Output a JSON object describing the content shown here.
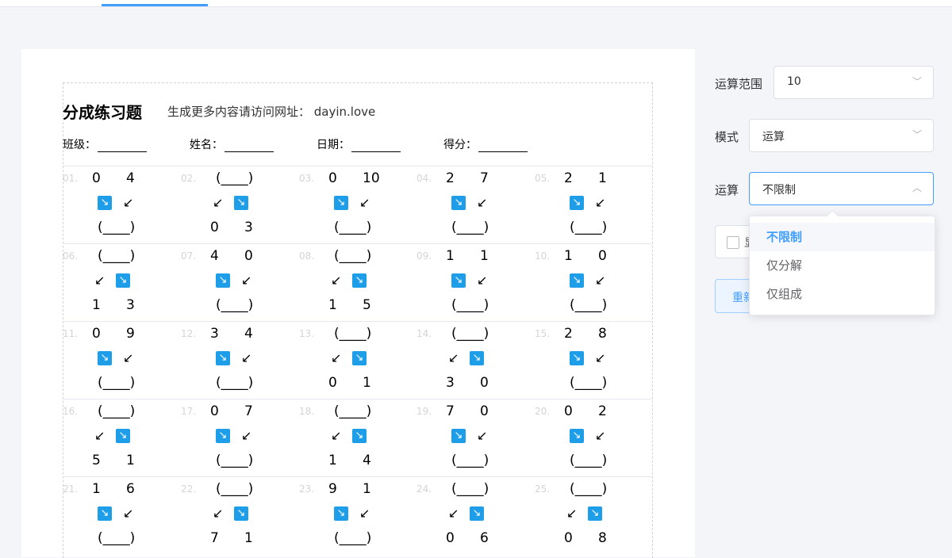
{
  "worksheet": {
    "title": "分成练习题",
    "subtitle": "生成更多内容请访问网址： dayin.love",
    "info": [
      "班级：",
      "姓名：",
      "日期：",
      "得分："
    ],
    "problems": [
      {
        "n": "01.",
        "type": "top",
        "a": "0",
        "b": "4"
      },
      {
        "n": "02.",
        "type": "bottom",
        "a": "0",
        "b": "3"
      },
      {
        "n": "03.",
        "type": "top",
        "a": "0",
        "b": "10"
      },
      {
        "n": "04.",
        "type": "top",
        "a": "2",
        "b": "7"
      },
      {
        "n": "05.",
        "type": "top",
        "a": "2",
        "b": "1"
      },
      {
        "n": "06.",
        "type": "bottom",
        "a": "1",
        "b": "3"
      },
      {
        "n": "07.",
        "type": "top",
        "a": "4",
        "b": "0"
      },
      {
        "n": "08.",
        "type": "bottom",
        "a": "1",
        "b": "5"
      },
      {
        "n": "09.",
        "type": "top",
        "a": "1",
        "b": "1"
      },
      {
        "n": "10.",
        "type": "top",
        "a": "1",
        "b": "0"
      },
      {
        "n": "11.",
        "type": "top",
        "a": "0",
        "b": "9"
      },
      {
        "n": "12.",
        "type": "top",
        "a": "3",
        "b": "4"
      },
      {
        "n": "13.",
        "type": "bottom",
        "a": "0",
        "b": "1"
      },
      {
        "n": "14.",
        "type": "bottom",
        "a": "3",
        "b": "0"
      },
      {
        "n": "15.",
        "type": "top",
        "a": "2",
        "b": "8"
      },
      {
        "n": "16.",
        "type": "bottom",
        "a": "5",
        "b": "1"
      },
      {
        "n": "17.",
        "type": "top",
        "a": "0",
        "b": "7"
      },
      {
        "n": "18.",
        "type": "bottom",
        "a": "1",
        "b": "4"
      },
      {
        "n": "19.",
        "type": "top",
        "a": "7",
        "b": "0"
      },
      {
        "n": "20.",
        "type": "top",
        "a": "0",
        "b": "2"
      },
      {
        "n": "21.",
        "type": "top",
        "a": "1",
        "b": "6"
      },
      {
        "n": "22.",
        "type": "bottom",
        "a": "7",
        "b": "1"
      },
      {
        "n": "23.",
        "type": "top",
        "a": "9",
        "b": "1"
      },
      {
        "n": "24.",
        "type": "bottom",
        "a": "0",
        "b": "6"
      },
      {
        "n": "25.",
        "type": "bottom",
        "a": "0",
        "b": "8"
      }
    ],
    "blank": "(____)",
    "arrow_badge_icon": "arrow-down-right-icon",
    "arrow_plain_icon": "arrow-down-left-icon"
  },
  "panel": {
    "range_label": "运算范围",
    "range_value": "10",
    "mode_label": "模式",
    "mode_value": "运算",
    "op_label": "运算",
    "op_value": "不限制",
    "checkbox_label": "显",
    "regen_label": "重新",
    "dropdown_options": [
      "不限制",
      "仅分解",
      "仅组成"
    ],
    "dropdown_selected": 0
  },
  "colors": {
    "accent": "#409eff",
    "badge": "#1e9ee8"
  }
}
